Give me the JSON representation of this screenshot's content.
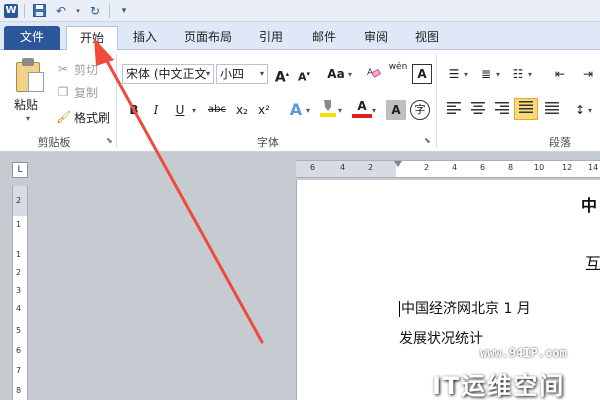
{
  "quick_access": {
    "logo_letter": "W",
    "icons": [
      "save-icon",
      "undo-icon",
      "redo-icon",
      "customize-icon"
    ]
  },
  "tabs": [
    {
      "label": "文件"
    },
    {
      "label": "开始"
    },
    {
      "label": "插入"
    },
    {
      "label": "页面布局"
    },
    {
      "label": "引用"
    },
    {
      "label": "邮件"
    },
    {
      "label": "审阅"
    },
    {
      "label": "视图"
    }
  ],
  "ribbon": {
    "clipboard": {
      "paste_label": "粘贴",
      "cut_label": "剪切",
      "copy_label": "复制",
      "format_painter_label": "格式刷",
      "group_label": "剪贴板"
    },
    "font": {
      "font_name": "宋体 (中文正文",
      "font_size": "小四",
      "grow_label": "A",
      "shrink_label": "A",
      "case_label": "Aa",
      "phonetic_label": "wén",
      "border_char_label": "A",
      "bold_label": "B",
      "italic_label": "I",
      "underline_label": "U",
      "strike_label": "abc",
      "subscript_label": "x₂",
      "superscript_label": "x²",
      "text_effect_label": "A",
      "font_color_label": "A",
      "char_shading_label": "A",
      "enclose_label": "字",
      "group_label": "字体"
    },
    "paragraph": {
      "group_label": "段落"
    }
  },
  "ruler": {
    "corner_label": "L",
    "h_numbers": [
      "6",
      "4",
      "2",
      "2",
      "4",
      "6",
      "8",
      "10",
      "12",
      "14"
    ],
    "v_numbers": [
      "2",
      "1",
      "1",
      "2",
      "3",
      "4",
      "5",
      "6",
      "7",
      "8"
    ]
  },
  "document": {
    "line1": "中",
    "line2": "互",
    "line3": "中国经济网北京 1 月",
    "line4": "发展状况统计"
  },
  "watermark": {
    "url": "www.94IP.com",
    "brand": "IT运维空间"
  },
  "colors": {
    "accent": "#2b579a",
    "arrow": "#f04a3c",
    "font_color_bar": "#e02020",
    "highlight_bar": "#f5e000"
  }
}
